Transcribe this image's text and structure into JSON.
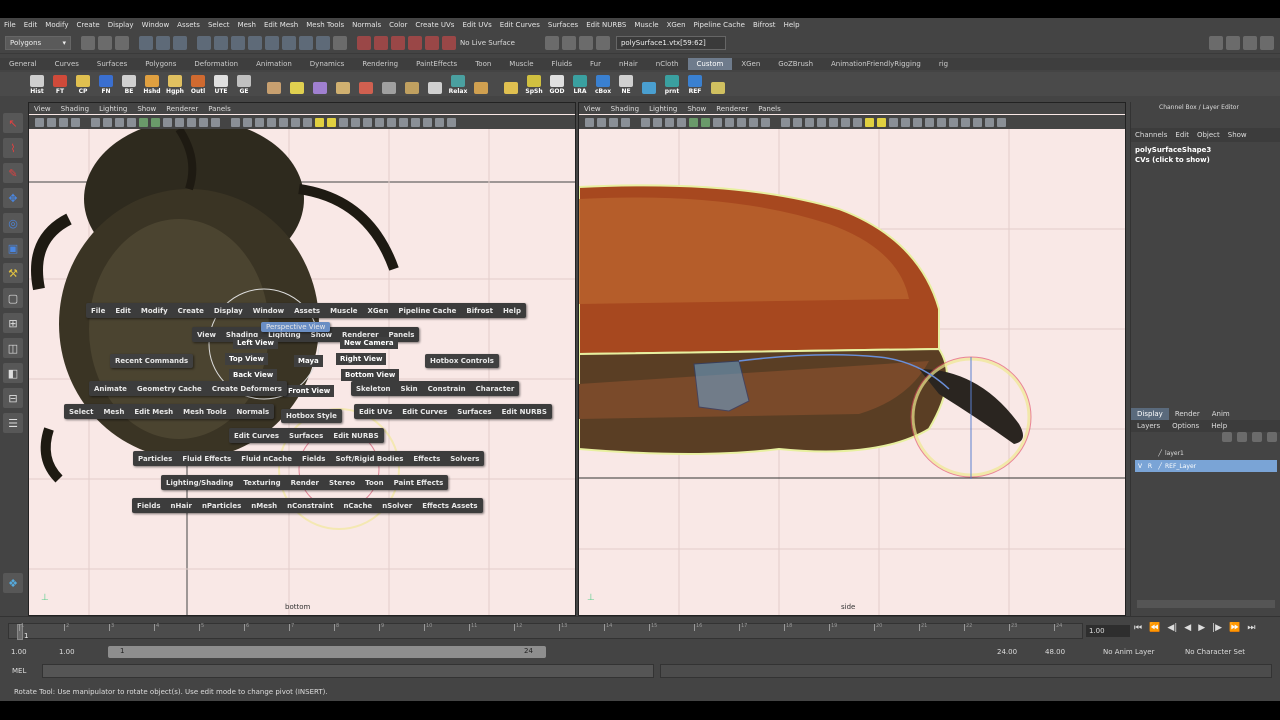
{
  "main_menu": [
    "File",
    "Edit",
    "Modify",
    "Create",
    "Display",
    "Window",
    "Assets",
    "Select",
    "Mesh",
    "Edit Mesh",
    "Mesh Tools",
    "Normals",
    "Color",
    "Create UVs",
    "Edit UVs",
    "Edit Curves",
    "Surfaces",
    "Edit NURBS",
    "Muscle",
    "XGen",
    "Pipeline Cache",
    "Bifrost",
    "Help"
  ],
  "status": {
    "mode": "Polygons",
    "live_surface": "No Live Surface",
    "selection_field": "polySurface1.vtx[59:62]"
  },
  "shelf_tabs": [
    "General",
    "Curves",
    "Surfaces",
    "Polygons",
    "Deformation",
    "Animation",
    "Dynamics",
    "Rendering",
    "PaintEffects",
    "Toon",
    "Muscle",
    "Fluids",
    "Fur",
    "nHair",
    "nCloth",
    "Custom",
    "XGen",
    "GoZBrush",
    "AnimationFriendlyRigging",
    "rig"
  ],
  "shelf_active": "Custom",
  "shelf_items": [
    "Hist",
    "FT",
    "CP",
    "FN",
    "BE",
    "Hshd",
    "Hgph",
    "Outl",
    "UTE",
    "GE",
    "",
    "",
    "",
    "",
    "",
    "",
    "",
    "",
    "Relax",
    "",
    "",
    "SpSh",
    "GOD",
    "LRA",
    "cBox",
    "NE",
    "",
    "prnt",
    "REF",
    ""
  ],
  "left_panel": {
    "menu": [
      "View",
      "Shading",
      "Lighting",
      "Show",
      "Renderer",
      "Panels"
    ],
    "camera": "bottom"
  },
  "right_panel": {
    "menu": [
      "View",
      "Shading",
      "Lighting",
      "Show",
      "Renderer",
      "Panels"
    ],
    "camera": "side"
  },
  "hotbox": {
    "top_menu": [
      "File",
      "Edit",
      "Modify",
      "Create",
      "Display",
      "Window",
      "Assets",
      "Muscle",
      "XGen",
      "Pipeline Cache",
      "Bifrost",
      "Help"
    ],
    "panel_menu": [
      "View",
      "Shading",
      "Lighting",
      "Show",
      "Renderer",
      "Panels"
    ],
    "highlight": "Perspective View",
    "views": {
      "left": "Left View",
      "new_camera": "New Camera",
      "top": "Top View",
      "right": "Right View",
      "back": "Back View",
      "bottom": "Bottom View",
      "front": "Front View",
      "maya": "Maya",
      "hotbox_style": "Hotbox Style"
    },
    "recent": "Recent Commands",
    "hotbox_controls": "Hotbox Controls",
    "row_anim": [
      "Animate",
      "Geometry Cache",
      "Create Deformers"
    ],
    "row_anim_right": [
      "Skeleton",
      "Skin",
      "Constrain",
      "Character"
    ],
    "row_select": [
      "Select",
      "Mesh",
      "Edit Mesh",
      "Mesh Tools",
      "Normals"
    ],
    "row_select_right": [
      "Edit UVs",
      "Edit Curves",
      "Surfaces",
      "Edit NURBS"
    ],
    "row_curves": [
      "Edit Curves",
      "Surfaces",
      "Edit NURBS"
    ],
    "row_dyn": [
      "Particles",
      "Fluid Effects",
      "Fluid nCache",
      "Fields",
      "Soft/Rigid Bodies",
      "Effects",
      "Solvers"
    ],
    "row_render": [
      "Lighting/Shading",
      "Texturing",
      "Render",
      "Stereo",
      "Toon",
      "Paint Effects"
    ],
    "row_ncloth": [
      "Fields",
      "nHair",
      "nParticles",
      "nMesh",
      "nConstraint",
      "nCache",
      "nSolver",
      "Effects Assets"
    ]
  },
  "channel_box": {
    "title": "Channel Box / Layer Editor",
    "menu": [
      "Channels",
      "Edit",
      "Object",
      "Show"
    ],
    "object": "polySurfaceShape3",
    "cvs": "CVs (click to show)",
    "layer_tabs": [
      "Display",
      "Render",
      "Anim"
    ],
    "layer_menu": [
      "Layers",
      "Options",
      "Help"
    ],
    "layers": [
      {
        "v": "",
        "r": "",
        "name": "layer1"
      },
      {
        "v": "V",
        "r": "R",
        "name": "REF_Layer"
      }
    ]
  },
  "timeline": {
    "ticks": [
      "1",
      "2",
      "3",
      "4",
      "5",
      "6",
      "7",
      "8",
      "9",
      "10",
      "11",
      "12",
      "13",
      "14",
      "15",
      "16",
      "17",
      "18",
      "19",
      "20",
      "21",
      "22",
      "23",
      "24"
    ],
    "current": "1",
    "current_field": "1.00"
  },
  "range": {
    "start": "1.00",
    "inner_start": "1.00",
    "slider_start": "1",
    "slider_end": "24",
    "end": "24.00",
    "outer_end": "48.00",
    "anim_layer": "No Anim Layer",
    "char_set": "No Character Set"
  },
  "mel_label": "MEL",
  "help_line": "Rotate Tool: Use manipulator to rotate object(s). Use edit mode to change pivot (INSERT).",
  "colors": {
    "viewport_bg": "#f9e8e6",
    "ui_bg": "#444444",
    "highlight": "#7aa4d6",
    "shelf_active": "#6e7b8c"
  }
}
